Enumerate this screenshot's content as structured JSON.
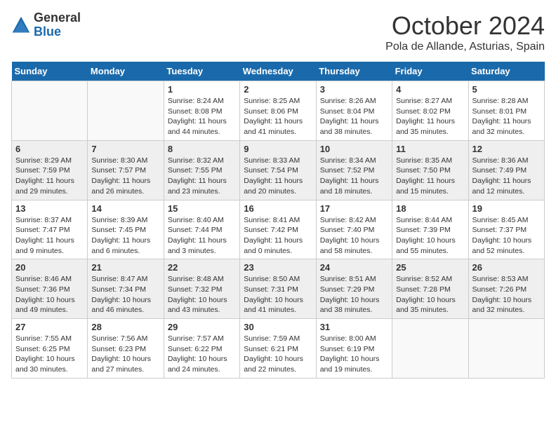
{
  "header": {
    "logo_general": "General",
    "logo_blue": "Blue",
    "month": "October 2024",
    "location": "Pola de Allande, Asturias, Spain"
  },
  "weekdays": [
    "Sunday",
    "Monday",
    "Tuesday",
    "Wednesday",
    "Thursday",
    "Friday",
    "Saturday"
  ],
  "weeks": [
    [
      {
        "day": "",
        "info": ""
      },
      {
        "day": "",
        "info": ""
      },
      {
        "day": "1",
        "info": "Sunrise: 8:24 AM\nSunset: 8:08 PM\nDaylight: 11 hours and 44 minutes."
      },
      {
        "day": "2",
        "info": "Sunrise: 8:25 AM\nSunset: 8:06 PM\nDaylight: 11 hours and 41 minutes."
      },
      {
        "day": "3",
        "info": "Sunrise: 8:26 AM\nSunset: 8:04 PM\nDaylight: 11 hours and 38 minutes."
      },
      {
        "day": "4",
        "info": "Sunrise: 8:27 AM\nSunset: 8:02 PM\nDaylight: 11 hours and 35 minutes."
      },
      {
        "day": "5",
        "info": "Sunrise: 8:28 AM\nSunset: 8:01 PM\nDaylight: 11 hours and 32 minutes."
      }
    ],
    [
      {
        "day": "6",
        "info": "Sunrise: 8:29 AM\nSunset: 7:59 PM\nDaylight: 11 hours and 29 minutes."
      },
      {
        "day": "7",
        "info": "Sunrise: 8:30 AM\nSunset: 7:57 PM\nDaylight: 11 hours and 26 minutes."
      },
      {
        "day": "8",
        "info": "Sunrise: 8:32 AM\nSunset: 7:55 PM\nDaylight: 11 hours and 23 minutes."
      },
      {
        "day": "9",
        "info": "Sunrise: 8:33 AM\nSunset: 7:54 PM\nDaylight: 11 hours and 20 minutes."
      },
      {
        "day": "10",
        "info": "Sunrise: 8:34 AM\nSunset: 7:52 PM\nDaylight: 11 hours and 18 minutes."
      },
      {
        "day": "11",
        "info": "Sunrise: 8:35 AM\nSunset: 7:50 PM\nDaylight: 11 hours and 15 minutes."
      },
      {
        "day": "12",
        "info": "Sunrise: 8:36 AM\nSunset: 7:49 PM\nDaylight: 11 hours and 12 minutes."
      }
    ],
    [
      {
        "day": "13",
        "info": "Sunrise: 8:37 AM\nSunset: 7:47 PM\nDaylight: 11 hours and 9 minutes."
      },
      {
        "day": "14",
        "info": "Sunrise: 8:39 AM\nSunset: 7:45 PM\nDaylight: 11 hours and 6 minutes."
      },
      {
        "day": "15",
        "info": "Sunrise: 8:40 AM\nSunset: 7:44 PM\nDaylight: 11 hours and 3 minutes."
      },
      {
        "day": "16",
        "info": "Sunrise: 8:41 AM\nSunset: 7:42 PM\nDaylight: 11 hours and 0 minutes."
      },
      {
        "day": "17",
        "info": "Sunrise: 8:42 AM\nSunset: 7:40 PM\nDaylight: 10 hours and 58 minutes."
      },
      {
        "day": "18",
        "info": "Sunrise: 8:44 AM\nSunset: 7:39 PM\nDaylight: 10 hours and 55 minutes."
      },
      {
        "day": "19",
        "info": "Sunrise: 8:45 AM\nSunset: 7:37 PM\nDaylight: 10 hours and 52 minutes."
      }
    ],
    [
      {
        "day": "20",
        "info": "Sunrise: 8:46 AM\nSunset: 7:36 PM\nDaylight: 10 hours and 49 minutes."
      },
      {
        "day": "21",
        "info": "Sunrise: 8:47 AM\nSunset: 7:34 PM\nDaylight: 10 hours and 46 minutes."
      },
      {
        "day": "22",
        "info": "Sunrise: 8:48 AM\nSunset: 7:32 PM\nDaylight: 10 hours and 43 minutes."
      },
      {
        "day": "23",
        "info": "Sunrise: 8:50 AM\nSunset: 7:31 PM\nDaylight: 10 hours and 41 minutes."
      },
      {
        "day": "24",
        "info": "Sunrise: 8:51 AM\nSunset: 7:29 PM\nDaylight: 10 hours and 38 minutes."
      },
      {
        "day": "25",
        "info": "Sunrise: 8:52 AM\nSunset: 7:28 PM\nDaylight: 10 hours and 35 minutes."
      },
      {
        "day": "26",
        "info": "Sunrise: 8:53 AM\nSunset: 7:26 PM\nDaylight: 10 hours and 32 minutes."
      }
    ],
    [
      {
        "day": "27",
        "info": "Sunrise: 7:55 AM\nSunset: 6:25 PM\nDaylight: 10 hours and 30 minutes."
      },
      {
        "day": "28",
        "info": "Sunrise: 7:56 AM\nSunset: 6:23 PM\nDaylight: 10 hours and 27 minutes."
      },
      {
        "day": "29",
        "info": "Sunrise: 7:57 AM\nSunset: 6:22 PM\nDaylight: 10 hours and 24 minutes."
      },
      {
        "day": "30",
        "info": "Sunrise: 7:59 AM\nSunset: 6:21 PM\nDaylight: 10 hours and 22 minutes."
      },
      {
        "day": "31",
        "info": "Sunrise: 8:00 AM\nSunset: 6:19 PM\nDaylight: 10 hours and 19 minutes."
      },
      {
        "day": "",
        "info": ""
      },
      {
        "day": "",
        "info": ""
      }
    ]
  ]
}
